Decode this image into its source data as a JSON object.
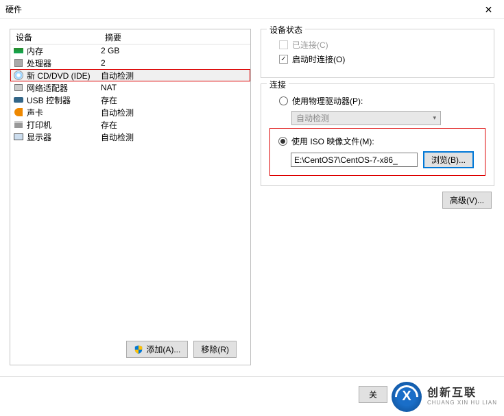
{
  "window": {
    "title": "硬件"
  },
  "list": {
    "header_device": "设备",
    "header_summary": "摘要",
    "rows": [
      {
        "name": "内存",
        "summary": "2 GB"
      },
      {
        "name": "处理器",
        "summary": "2"
      },
      {
        "name": "新 CD/DVD (IDE)",
        "summary": "自动检测"
      },
      {
        "name": "网络适配器",
        "summary": "NAT"
      },
      {
        "name": "USB 控制器",
        "summary": "存在"
      },
      {
        "name": "声卡",
        "summary": "自动检测"
      },
      {
        "name": "打印机",
        "summary": "存在"
      },
      {
        "name": "显示器",
        "summary": "自动检测"
      }
    ],
    "add_label": "添加(A)...",
    "remove_label": "移除(R)"
  },
  "status": {
    "legend": "设备状态",
    "connected": "已连接(C)",
    "connect_on_power": "启动时连接(O)"
  },
  "connection": {
    "legend": "连接",
    "use_physical": "使用物理驱动器(P):",
    "auto_detect": "自动检测",
    "use_iso": "使用 ISO 映像文件(M):",
    "iso_path": "E:\\CentOS7\\CentOS-7-x86_",
    "browse": "浏览(B)..."
  },
  "advanced_label": "高级(V)...",
  "close_label": "关",
  "brand": {
    "cn": "创新互联",
    "en": "CHUANG XIN HU LIAN"
  }
}
